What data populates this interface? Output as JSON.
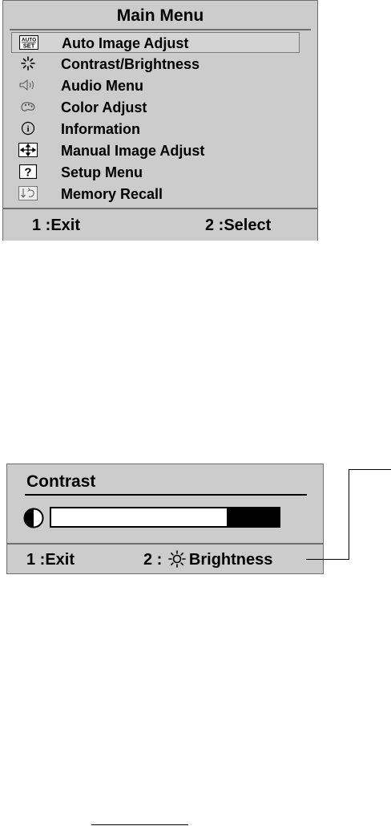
{
  "main_menu": {
    "title": "Main Menu",
    "items": [
      {
        "icon": "auto-set-icon",
        "label": "Auto Image Adjust",
        "selected": true
      },
      {
        "icon": "contrast-brightness-icon",
        "label": "Contrast/Brightness"
      },
      {
        "icon": "audio-speaker-icon",
        "label": "Audio Menu"
      },
      {
        "icon": "color-palette-icon",
        "label": "Color Adjust"
      },
      {
        "icon": "information-icon",
        "label": "Information"
      },
      {
        "icon": "move-arrows-icon",
        "label": "Manual Image Adjust"
      },
      {
        "icon": "question-icon",
        "label": "Setup Menu"
      },
      {
        "icon": "memory-recall-icon",
        "label": "Memory Recall"
      }
    ],
    "auto_icon_text": {
      "top": "AUTO",
      "bottom": "SET"
    },
    "question_icon_text": "?",
    "info_icon_text": "i",
    "footer": {
      "exit": "1 :Exit",
      "select": "2 :Select"
    }
  },
  "contrast_panel": {
    "title": "Contrast",
    "level_fraction": 0.77,
    "footer": {
      "exit": "1 :Exit",
      "select_prefix": "2 :",
      "select_label": "Brightness"
    }
  },
  "colors": {
    "osd_background": "#cccccc",
    "border": "#6e6e6e"
  }
}
